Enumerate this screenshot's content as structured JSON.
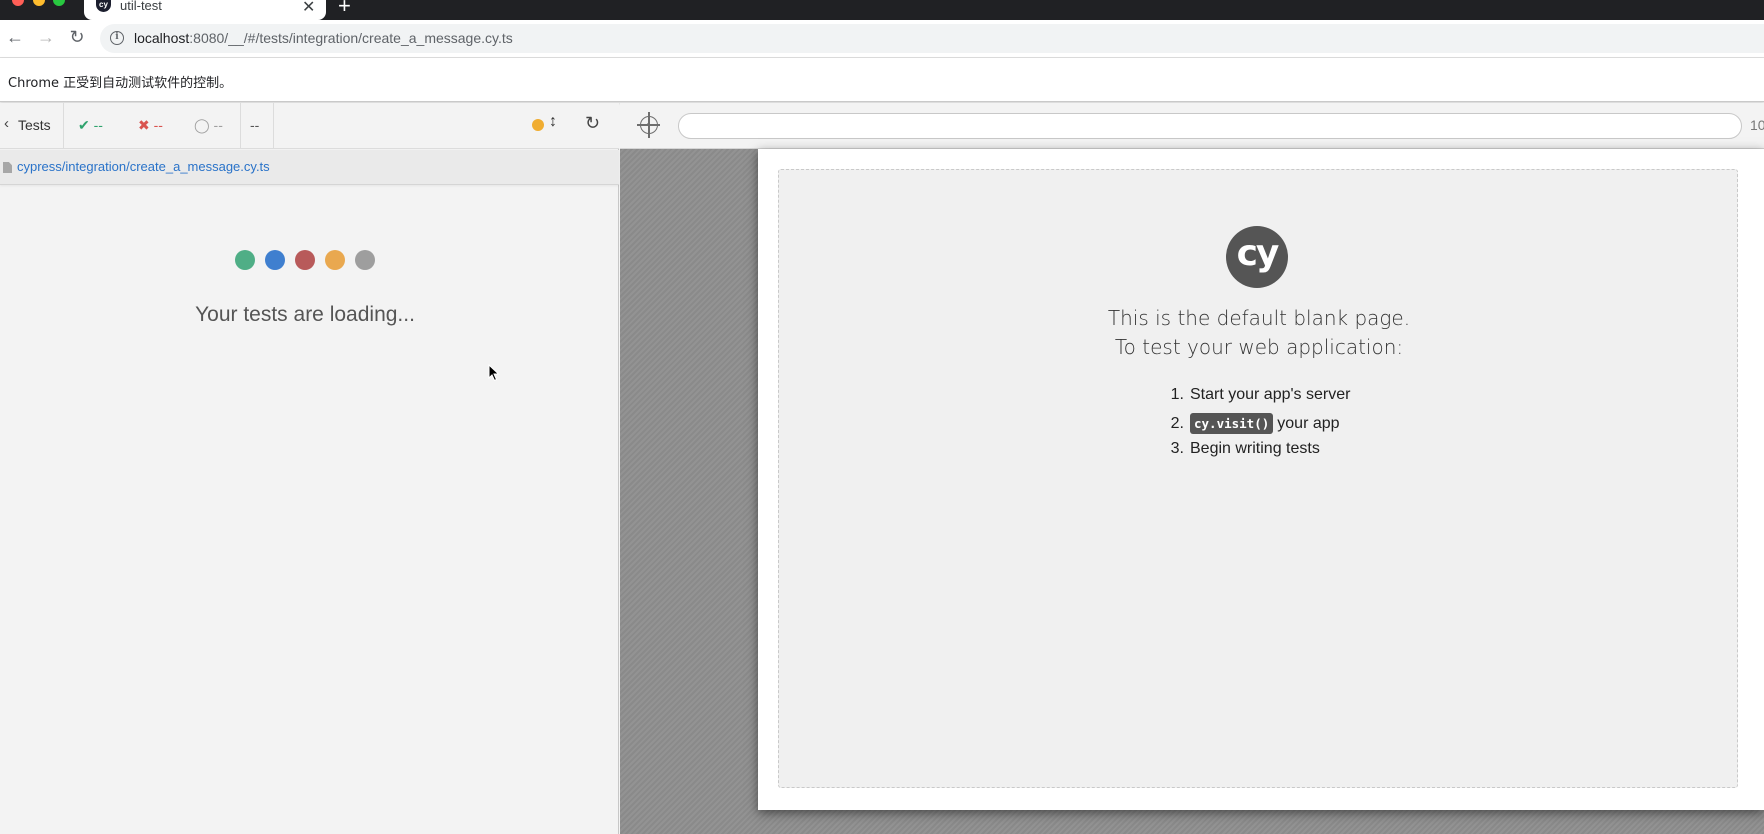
{
  "browser": {
    "tab_title": "util-test",
    "tab_favicon": "cy",
    "close_glyph": "✕",
    "newtab_glyph": "+",
    "url_host": "localhost",
    "url_rest": ":8080/__/#/tests/integration/create_a_message.cy.ts",
    "back_glyph": "←",
    "forward_glyph": "→",
    "reload_glyph": "↻",
    "info_glyph": "i",
    "automation_notice": "Chrome 正受到自动测试软件的控制。"
  },
  "reporter": {
    "tests_label": "Tests",
    "back_glyph": "‹",
    "passed": "✔ --",
    "failed": "✖ --",
    "pending": "◯ --",
    "duration": "--",
    "scroll_glyph": "↕",
    "restart_glyph": "↻",
    "spec_path": "cypress/integration/create_a_message.cy.ts",
    "loading_text": "Your tests are loading...",
    "loader_colors": [
      "#4fae86",
      "#3f7fcf",
      "#b85a5a",
      "#e9a84f",
      "#9e9e9e"
    ]
  },
  "aut": {
    "viewport_info": "10",
    "logo_text": "cy",
    "heading_line1": "This is the default blank page.",
    "heading_line2": "To test your web application:",
    "steps": [
      {
        "num": "1.",
        "text": "Start your app's server"
      },
      {
        "num": "2.",
        "code": "cy.visit()",
        "text": "your app"
      },
      {
        "num": "3.",
        "text": "Begin writing tests"
      }
    ]
  }
}
